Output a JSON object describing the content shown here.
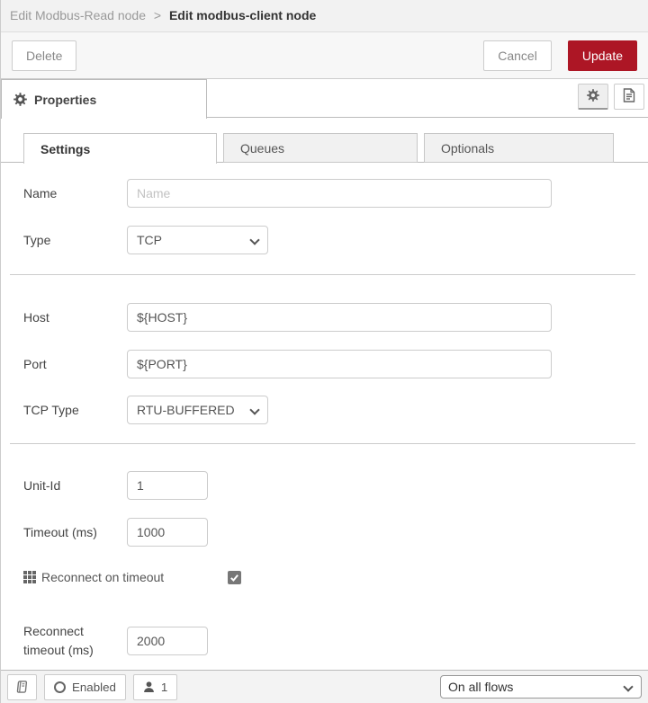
{
  "breadcrumb": {
    "parent": "Edit Modbus-Read node",
    "separator": ">",
    "current": "Edit modbus-client node"
  },
  "toolbar": {
    "delete_label": "Delete",
    "cancel_label": "Cancel",
    "update_label": "Update"
  },
  "properties_tab": {
    "label": "Properties"
  },
  "tabs": {
    "settings": "Settings",
    "queues": "Queues",
    "optionals": "Optionals",
    "active": "Settings"
  },
  "form": {
    "name": {
      "label": "Name",
      "placeholder": "Name",
      "value": ""
    },
    "type": {
      "label": "Type",
      "value": "TCP"
    },
    "host": {
      "label": "Host",
      "value": "${HOST}"
    },
    "port": {
      "label": "Port",
      "value": "${PORT}"
    },
    "tcp_type": {
      "label": "TCP Type",
      "value": "RTU-BUFFERED"
    },
    "unit_id": {
      "label": "Unit-Id",
      "value": "1"
    },
    "timeout": {
      "label": "Timeout (ms)",
      "value": "1000"
    },
    "reconnect_on_timeout": {
      "label": "Reconnect on timeout",
      "checked": true
    },
    "reconnect_timeout": {
      "label": "Reconnect timeout (ms)",
      "value": "2000"
    }
  },
  "footer": {
    "enabled_label": "Enabled",
    "user_count": "1",
    "scope_value": "On all flows"
  },
  "colors": {
    "accent_red": "#AD1625",
    "tab_inactive_bg": "#f1f1f1",
    "header_bg": "#f2f2f2"
  }
}
